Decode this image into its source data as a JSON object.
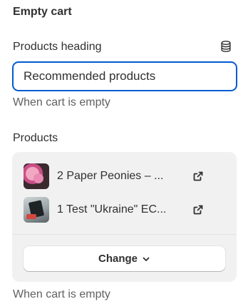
{
  "section": {
    "title": "Empty cart"
  },
  "heading_field": {
    "label": "Products heading",
    "value": "Recommended products",
    "help": "When cart is empty",
    "icon": "database-icon"
  },
  "products_field": {
    "label": "Products",
    "items": [
      {
        "name": "2 Paper Peonies – ...",
        "icon": "external-link-icon"
      },
      {
        "name": "1 Test \"Ukraine\" EC...",
        "icon": "external-link-icon"
      }
    ],
    "change_label": "Change",
    "help": "When cart is empty"
  },
  "colors": {
    "focus_border": "#005bd3",
    "box_bg": "#f1f1f1",
    "text": "#303030",
    "subdued": "#616161"
  }
}
